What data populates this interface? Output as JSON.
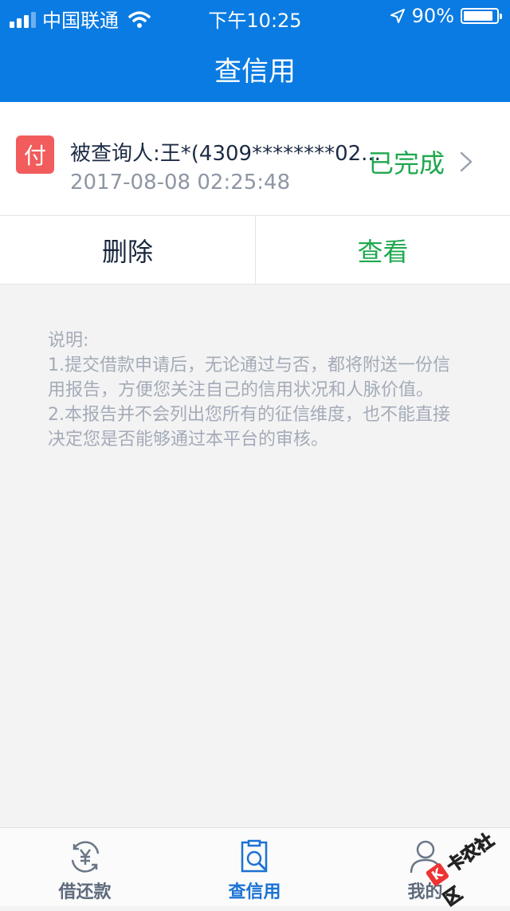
{
  "status_bar": {
    "carrier": "中国联通",
    "time": "下午10:25",
    "battery_percent": "90%",
    "battery_level": 0.9,
    "icons": [
      "signal-bars-icon",
      "wifi-icon",
      "location-arrow-icon",
      "battery-icon"
    ]
  },
  "nav": {
    "title": "查信用"
  },
  "record": {
    "badge": "付",
    "title": "被查询人:王*(4309********02...",
    "time": "2017-08-08 02:25:48",
    "status": "已完成",
    "delete_label": "删除",
    "view_label": "查看"
  },
  "notes": {
    "heading": "说明:",
    "line1": "1.提交借款申请后，无论通过与否，都将附送一份信用报告，方便您关注自己的信用状况和人脉价值。",
    "line2": "2.本报告并不会列出您所有的征信维度，也不能直接决定您是否能够通过本平台的审核。"
  },
  "tabbar": {
    "tabs": [
      {
        "label": "借还款",
        "icon": "yuan-exchange-icon",
        "active": false
      },
      {
        "label": "查信用",
        "icon": "credit-search-icon",
        "active": true
      },
      {
        "label": "我的",
        "icon": "person-icon",
        "active": false
      }
    ]
  },
  "watermark": {
    "text": "卡农社区",
    "badge": "K"
  },
  "colors": {
    "brand_blue": "#0a7be2",
    "status_green": "#1fa84e",
    "badge_red": "#f25c5c",
    "active_tab": "#1b72d4"
  }
}
